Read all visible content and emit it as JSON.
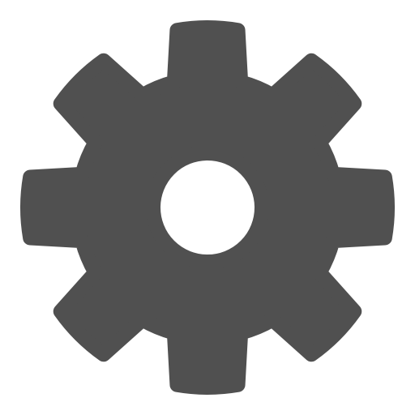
{
  "icon": {
    "name": "gear-icon",
    "color": "#505050",
    "background": "#ffffff"
  }
}
